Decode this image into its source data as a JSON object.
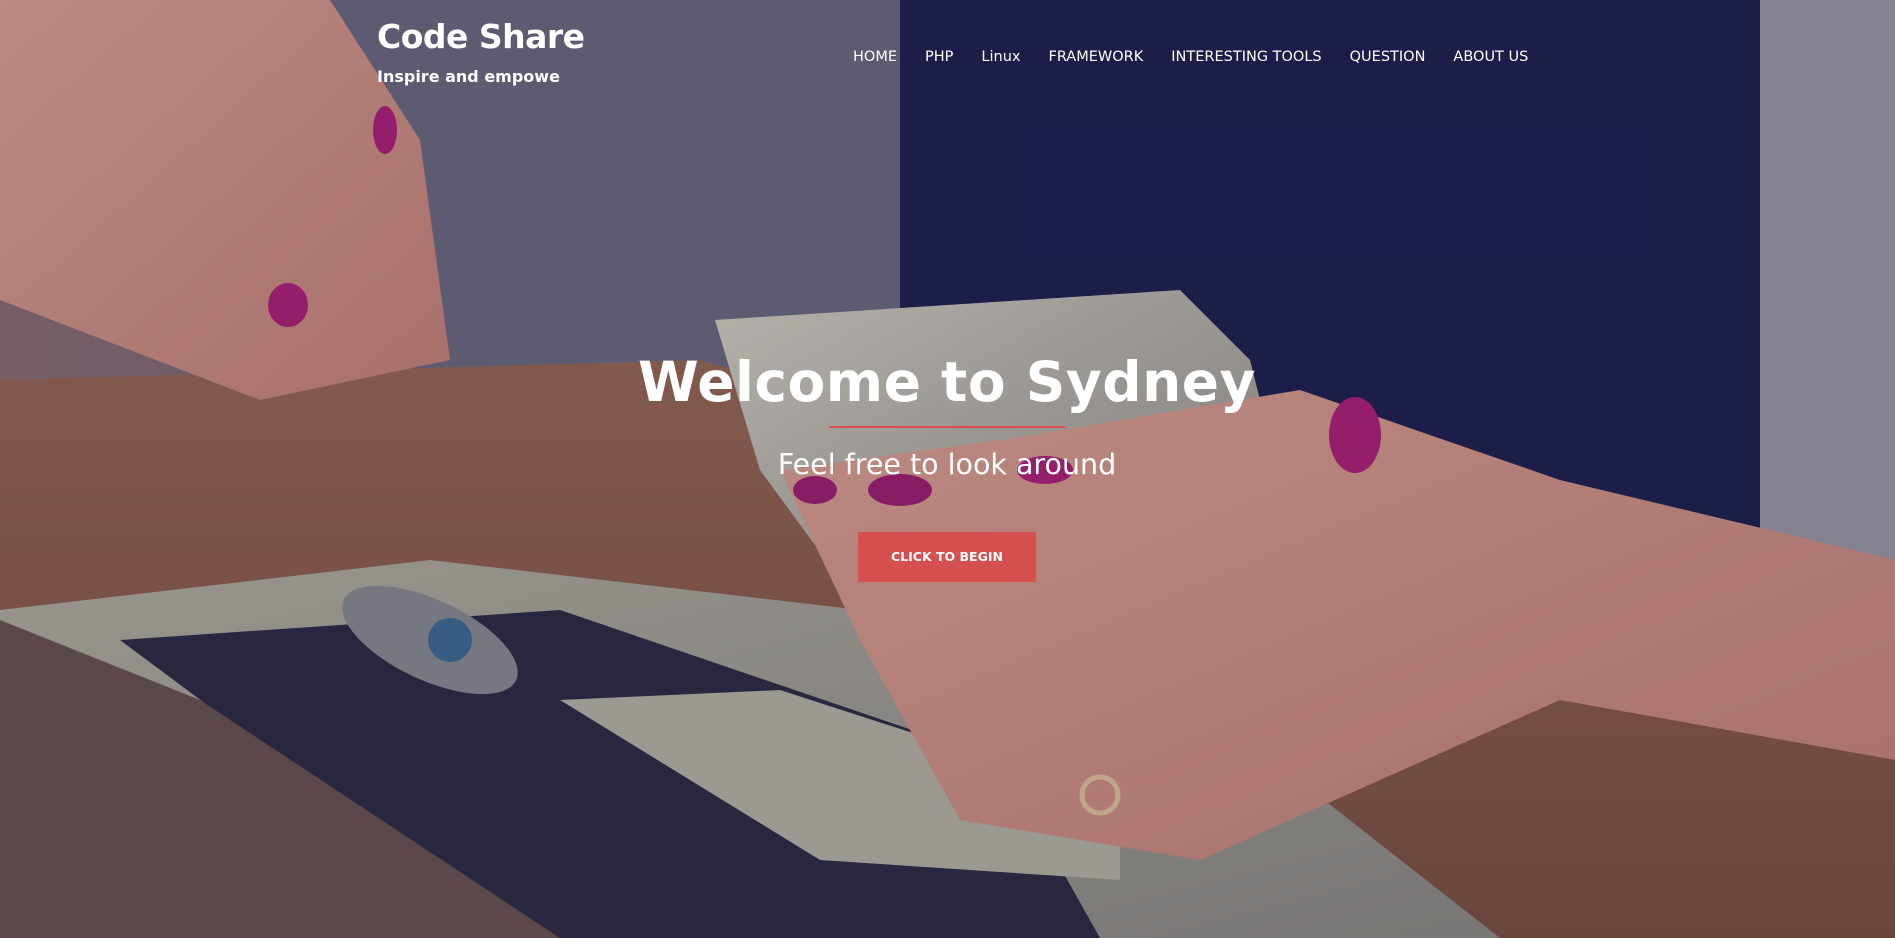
{
  "header": {
    "site_title": "Code Share",
    "tagline": "Inspire and empowe"
  },
  "nav": {
    "items": [
      {
        "label": "HOME"
      },
      {
        "label": "PHP"
      },
      {
        "label": "Linux"
      },
      {
        "label": "FRAMEWORK"
      },
      {
        "label": "INTERESTING TOOLS"
      },
      {
        "label": "QUESTION"
      },
      {
        "label": "ABOUT US"
      }
    ]
  },
  "hero": {
    "title": "Welcome to Sydney",
    "subtitle": "Feel free to look around",
    "button_label": "CLICK TO BEGIN"
  },
  "colors": {
    "accent": "#d65050",
    "text": "#ffffff",
    "photo_dark": "#1f1f4d"
  }
}
